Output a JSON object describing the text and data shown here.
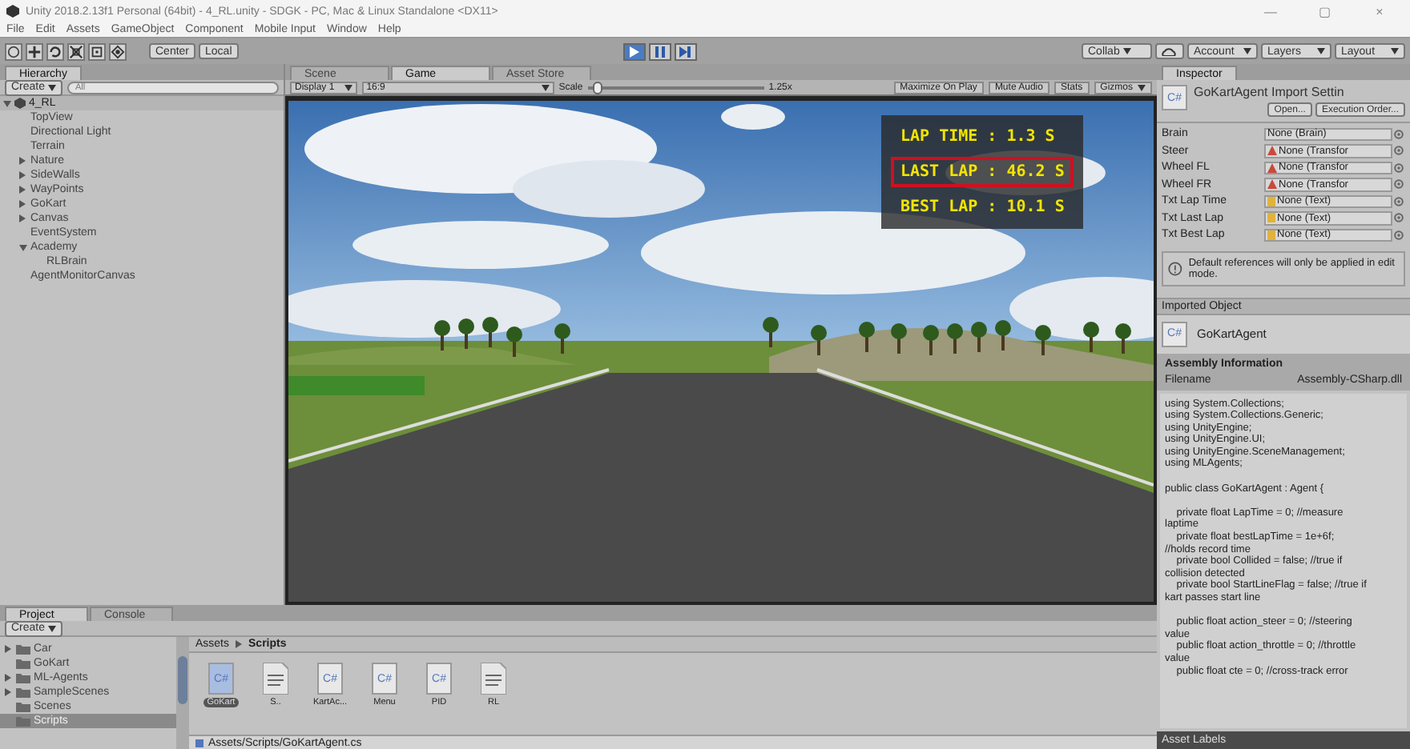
{
  "window": {
    "title": "Unity 2018.2.13f1 Personal (64bit) - 4_RL.unity - SDGK - PC, Mac & Linux Standalone <DX11>",
    "controls": [
      "—",
      "▢",
      "×"
    ]
  },
  "menu": [
    "File",
    "Edit",
    "Assets",
    "GameObject",
    "Component",
    "Mobile Input",
    "Window",
    "Help"
  ],
  "toolbar": {
    "pivot": "Center",
    "space": "Local",
    "playing": true,
    "paused": false,
    "collab": "Collab",
    "right_buttons": [
      "Account",
      "Layers",
      "Layout"
    ]
  },
  "hierarchy": {
    "tab": "Hierarchy",
    "create": "Create",
    "search_placeholder": "All",
    "scene": "4_RL",
    "items": [
      {
        "label": "TopView",
        "kind": "object"
      },
      {
        "label": "Directional Light",
        "kind": "object"
      },
      {
        "label": "Terrain",
        "kind": "object"
      },
      {
        "label": "Nature",
        "kind": "group",
        "expanded": false
      },
      {
        "label": "SideWalls",
        "kind": "group",
        "expanded": false
      },
      {
        "label": "WayPoints",
        "kind": "group",
        "expanded": false
      },
      {
        "label": "GoKart",
        "kind": "group",
        "expanded": false
      },
      {
        "label": "Canvas",
        "kind": "group",
        "expanded": false
      },
      {
        "label": "EventSystem",
        "kind": "object"
      },
      {
        "label": "Academy",
        "kind": "group",
        "expanded": true,
        "children": [
          {
            "label": "RLBrain",
            "kind": "object"
          }
        ]
      },
      {
        "label": "AgentMonitorCanvas",
        "kind": "object"
      }
    ]
  },
  "view_tabs": [
    {
      "label": "Scene",
      "selected": false
    },
    {
      "label": "Game",
      "selected": true
    },
    {
      "label": "Asset Store",
      "selected": false
    }
  ],
  "game_toolbar": {
    "display": "Display 1",
    "aspect": "16:9",
    "scale_label": "Scale",
    "scale": {
      "level": 0.03
    },
    "scale_value": "1.25x",
    "buttons": [
      "Maximize On Play",
      "Mute Audio",
      "Stats",
      "Gizmos"
    ]
  },
  "hud": [
    {
      "label": "LAP TIME : 1.3 S",
      "highlighted": false
    },
    {
      "label": "LAST LAP : 46.2 S",
      "highlighted": true
    },
    {
      "label": "BEST LAP : 10.1 S",
      "highlighted": false
    }
  ],
  "inspector": {
    "tab": "Inspector",
    "script_badge": "C#",
    "title": "GoKartAgent Import Settin",
    "buttons": [
      "Open...",
      "Execution Order..."
    ],
    "fields": [
      {
        "label": "Brain",
        "value": "None (Brain)",
        "kind": "object"
      },
      {
        "label": "Steer",
        "value": "None (Transfor",
        "kind": "transform"
      },
      {
        "label": "Wheel FL",
        "value": "None (Transfor",
        "kind": "transform"
      },
      {
        "label": "Wheel FR",
        "value": "None (Transfor",
        "kind": "transform"
      },
      {
        "label": "Txt Lap Time",
        "value": "None (Text)",
        "kind": "text"
      },
      {
        "label": "Txt Last Lap",
        "value": "None (Text)",
        "kind": "text"
      },
      {
        "label": "Txt Best Lap",
        "value": "None (Text)",
        "kind": "text"
      }
    ],
    "note": "Default references will only be applied in edit mode.",
    "imported_header": "Imported Object",
    "object_badge": "C#",
    "object_name": "GoKartAgent",
    "assembly_title": "Assembly Information",
    "filename_label": "Filename",
    "filename": "Assembly-CSharp.dll",
    "code": [
      [
        "using System.Collections;",
        "using System.Collections.Generic;",
        "using UnityEngine;",
        "using UnityEngine.UI;",
        "using UnityEngine.SceneManagement;",
        "using MLAgents;"
      ],
      [
        "public class GoKartAgent : Agent {"
      ],
      [
        "    private float LapTime = 0; //measure",
        "laptime",
        "    private float bestLapTime = 1e+6f;",
        "//holds record time",
        "    private bool Collided = false; //true if",
        "collision detected",
        "    private bool StartLineFlag = false; //true if",
        "kart passes start line"
      ],
      [
        "    public float action_steer = 0; //steering",
        "value",
        "    public float action_throttle = 0; //throttle",
        "value",
        "    public float cte = 0; //cross-track error"
      ]
    ],
    "labels_header": "Asset Labels"
  },
  "project": {
    "tabs": [
      {
        "label": "Project",
        "selected": true
      },
      {
        "label": "Console",
        "selected": false
      }
    ],
    "create": "Create",
    "tree": [
      {
        "label": "Car",
        "kind": "group",
        "selected": false
      },
      {
        "label": "GoKart",
        "kind": "leaf",
        "selected": false
      },
      {
        "label": "ML-Agents",
        "kind": "group",
        "selected": false
      },
      {
        "label": "SampleScenes",
        "kind": "group",
        "selected": false
      },
      {
        "label": "Scenes",
        "kind": "leaf",
        "selected": false
      },
      {
        "label": "Scripts",
        "kind": "leaf",
        "selected": true
      }
    ],
    "breadcrumb": [
      "Assets",
      "Scripts"
    ],
    "files": [
      {
        "name": "GoKart",
        "kind": "script",
        "badge": "C#",
        "selected": true
      },
      {
        "name": "S..",
        "kind": "document",
        "selected": false
      },
      {
        "name": "KartAc...",
        "kind": "script",
        "badge": "C#",
        "selected": false
      },
      {
        "name": "Menu",
        "kind": "script",
        "badge": "C#",
        "selected": false
      },
      {
        "name": "PID",
        "kind": "script",
        "badge": "C#",
        "selected": false
      },
      {
        "name": "RL",
        "kind": "document",
        "selected": false
      }
    ],
    "path": "Assets/Scripts/GoKartAgent.cs"
  }
}
